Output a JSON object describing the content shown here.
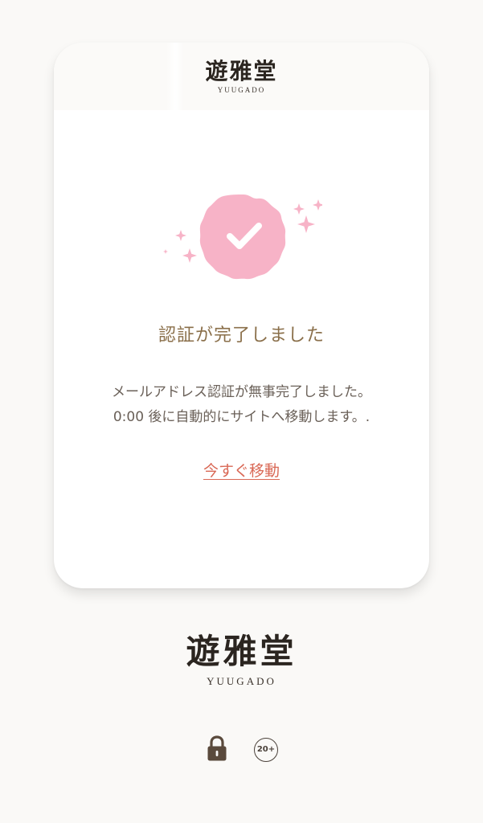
{
  "brand": {
    "kanji": "遊雅堂",
    "romaji": "YUUGADO"
  },
  "verification": {
    "title": "認証が完了しました",
    "message_line1": "メールアドレス認証が無事完了しました。",
    "message_line2": "0:00 後に自動的にサイトへ移動します。.",
    "move_now_label": "今すぐ移動"
  },
  "footer": {
    "age_badge": "20+"
  },
  "colors": {
    "accent_pink": "#f7b3c7",
    "title_gold": "#8a6f4a",
    "link_red": "#d96855",
    "background": "#faf9f7"
  },
  "icons": {
    "verified": "check-badge-icon",
    "sparkles": "sparkle-icon",
    "lock": "lock-icon",
    "age": "age-20-plus-icon"
  }
}
